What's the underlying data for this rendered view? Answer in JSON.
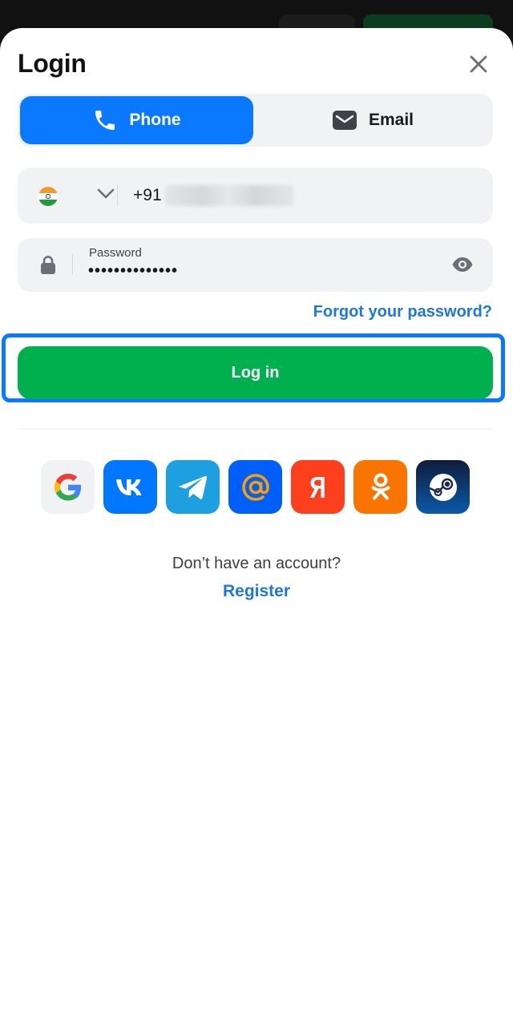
{
  "header": {
    "title": "Login",
    "close_icon": "close-icon"
  },
  "tabs": [
    {
      "label": "Phone",
      "icon": "phone-icon",
      "active": true
    },
    {
      "label": "Email",
      "icon": "email-icon",
      "active": false
    }
  ],
  "phone_field": {
    "country_flag": "india-flag-icon",
    "prefix": "+91"
  },
  "password_field": {
    "label": "Password",
    "value": "••••••••••••••"
  },
  "forgot_link": "Forgot your password?",
  "login_button": "Log in",
  "social_providers": [
    "google",
    "vk",
    "telegram",
    "mail",
    "yandex",
    "odnoklassniki",
    "steam"
  ],
  "footer": {
    "prompt": "Don’t have an account?",
    "register_link": "Register"
  },
  "colors": {
    "accent_blue": "#0a79ff",
    "link_blue": "#1e78d8",
    "login_green": "#00b04f",
    "field_bg": "#f1f2f4"
  }
}
